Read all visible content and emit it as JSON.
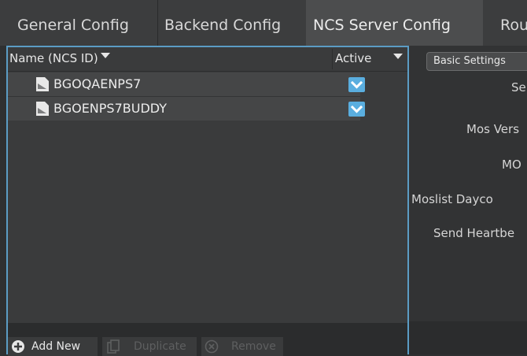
{
  "tabs": [
    {
      "label": "General Config",
      "active": false
    },
    {
      "label": "Backend Config",
      "active": false
    },
    {
      "label": "NCS Server Config",
      "active": true
    },
    {
      "label": "Rou",
      "active": false
    }
  ],
  "table": {
    "columns": {
      "name": "Name (NCS ID)",
      "active": "Active"
    },
    "rows": [
      {
        "name": "BGOQAENPS7",
        "active": true
      },
      {
        "name": "BGOENPS7BUDDY",
        "active": true
      }
    ]
  },
  "actions": {
    "add_new": "Add New",
    "duplicate": "Duplicate",
    "remove": "Remove"
  },
  "right_panel": {
    "tab_label": "Basic Settings",
    "labels": [
      "Serve",
      "Mos Vers",
      "MO",
      "Moslist Dayco",
      "Send Heartbe"
    ]
  },
  "colors": {
    "accent": "#5aaedf",
    "selection_border": "#5b9cc4"
  },
  "icons": {
    "row": "file-icon",
    "active": "checkbox-checked-icon",
    "add": "plus-circle-icon",
    "duplicate": "copy-icon",
    "remove": "x-circle-icon"
  }
}
